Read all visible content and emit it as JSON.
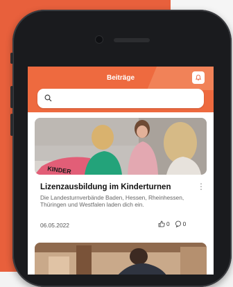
{
  "header": {
    "title": "Beiträge",
    "bell_icon": "bell-icon",
    "accent_color": "#ee6a3f"
  },
  "search": {
    "icon": "search-icon",
    "placeholder": "",
    "value": ""
  },
  "posts": [
    {
      "title": "Lizenzausbildung im Kinderturnen",
      "excerpt": "Die Landesturnverbände Baden, Hessen, Rheinhessen, Thüringen und Westfalen laden dich ein.",
      "date": "06.05.2022",
      "likes": "0",
      "comments": "0",
      "image_text": "KINDER"
    }
  ]
}
